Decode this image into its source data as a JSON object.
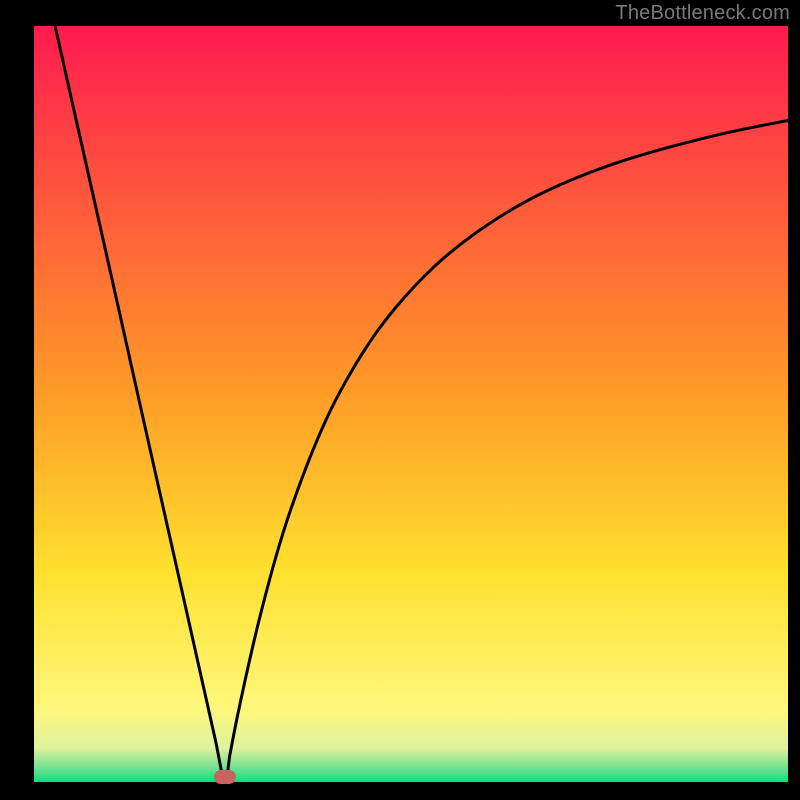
{
  "watermark": "TheBottleneck.com",
  "chart_data": {
    "type": "line",
    "title": "",
    "xlabel": "",
    "ylabel": "",
    "xlim": [
      0,
      100
    ],
    "ylim": [
      0,
      100
    ],
    "background": {
      "type": "gradient",
      "stops": [
        {
          "pos": 0.0,
          "color": "#ff1b4f"
        },
        {
          "pos": 0.48,
          "color": "#ff9a27"
        },
        {
          "pos": 0.72,
          "color": "#ffe02e"
        },
        {
          "pos": 0.9,
          "color": "#fff77a"
        },
        {
          "pos": 0.955,
          "color": "#dff29d"
        },
        {
          "pos": 0.985,
          "color": "#5fe08e"
        },
        {
          "pos": 1.0,
          "color": "#00e47a"
        }
      ]
    },
    "curve": {
      "min_x": 25.3,
      "left": {
        "start_x": 2.8,
        "start_y": 100
      },
      "right_asymptote_y": 89,
      "samples_x": [
        2.8,
        5,
        8,
        11,
        14,
        17,
        20,
        22,
        24,
        25.3,
        26,
        27,
        28.5,
        30,
        32,
        34,
        37,
        40,
        44,
        48,
        53,
        58,
        64,
        70,
        77,
        84,
        92,
        100
      ],
      "samples_y": [
        100,
        90.2,
        76.9,
        63.6,
        50.2,
        36.9,
        23.6,
        14.7,
        5.8,
        0,
        3.7,
        8.8,
        15.7,
        22,
        29.5,
        35.9,
        43.9,
        50.5,
        57.4,
        62.8,
        68.1,
        72.2,
        76.1,
        79.1,
        81.8,
        83.9,
        85.9,
        87.5
      ]
    },
    "marker": {
      "x": 25.3,
      "y": 0.7,
      "shape": "pill",
      "fill": "#c86460"
    }
  }
}
